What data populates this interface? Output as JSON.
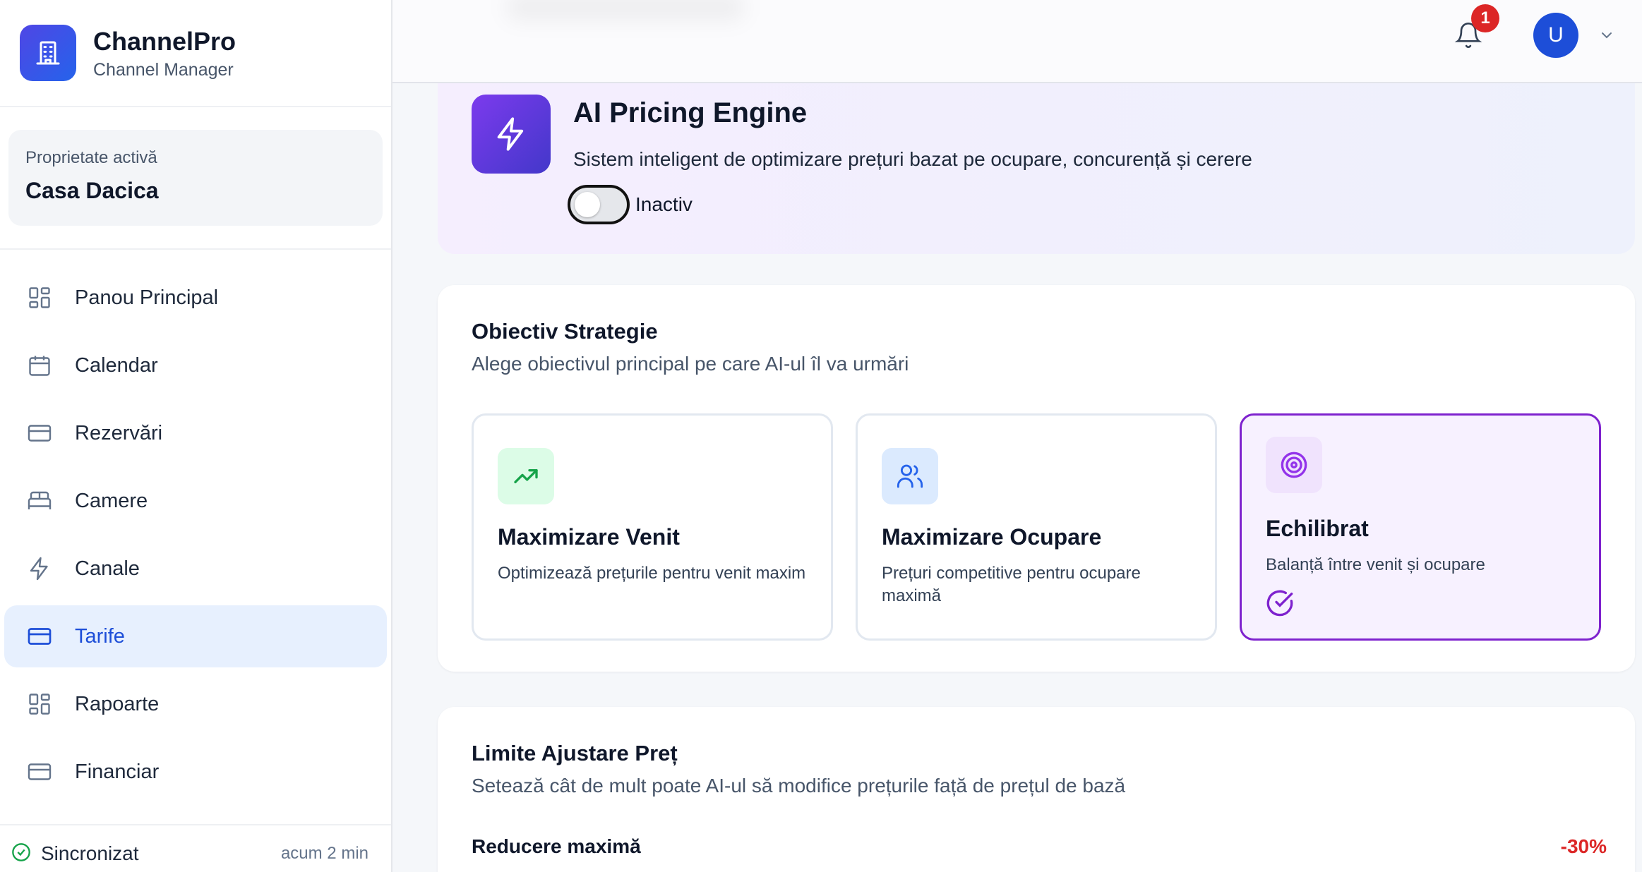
{
  "brand": {
    "name": "ChannelPro",
    "subtitle": "Channel Manager",
    "icon": "building-icon"
  },
  "property": {
    "label": "Proprietate activă",
    "name": "Casa Dacica"
  },
  "nav": [
    {
      "label": "Panou Principal",
      "icon": "grid-icon",
      "active": false
    },
    {
      "label": "Calendar",
      "icon": "calendar-icon",
      "active": false
    },
    {
      "label": "Rezervări",
      "icon": "card-icon",
      "active": false
    },
    {
      "label": "Camere",
      "icon": "bed-icon",
      "active": false
    },
    {
      "label": "Canale",
      "icon": "lightning-icon",
      "active": false
    },
    {
      "label": "Tarife",
      "icon": "card-icon",
      "active": true
    },
    {
      "label": "Rapoarte",
      "icon": "grid-icon",
      "active": false
    },
    {
      "label": "Financiar",
      "icon": "card-icon",
      "active": false
    }
  ],
  "sync": {
    "label": "Sincronizat",
    "time": "acum 2 min"
  },
  "header": {
    "notification_count": "1",
    "avatar_initial": "U"
  },
  "engine": {
    "title": "AI Pricing Engine",
    "description": "Sistem inteligent de optimizare prețuri bazat pe ocupare, concurență și cerere",
    "toggle_label": "Inactiv",
    "enabled": false
  },
  "strategy": {
    "title": "Obiectiv Strategie",
    "subtitle": "Alege obiectivul principal pe care AI-ul îl va urmări",
    "options": [
      {
        "title": "Maximizare Venit",
        "description": "Optimizează prețurile pentru venit maxim",
        "icon": "trending-up-icon",
        "selected": false
      },
      {
        "title": "Maximizare Ocupare",
        "description": "Prețuri competitive pentru ocupare maximă",
        "icon": "users-icon",
        "selected": false
      },
      {
        "title": "Echilibrat",
        "description": "Balanță între venit și ocupare",
        "icon": "target-icon",
        "selected": true
      }
    ]
  },
  "limits": {
    "title": "Limite Ajustare Preț",
    "subtitle": "Setează cât de mult poate AI-ul să modifice prețurile față de prețul de bază",
    "max_reduction_label": "Reducere maximă",
    "max_reduction_value": "-30%"
  },
  "colors": {
    "accent": "#1d4ed8",
    "brand": "#4f46e5",
    "purple": "#7e22ce",
    "danger": "#dc2626",
    "success": "#16a34a"
  }
}
